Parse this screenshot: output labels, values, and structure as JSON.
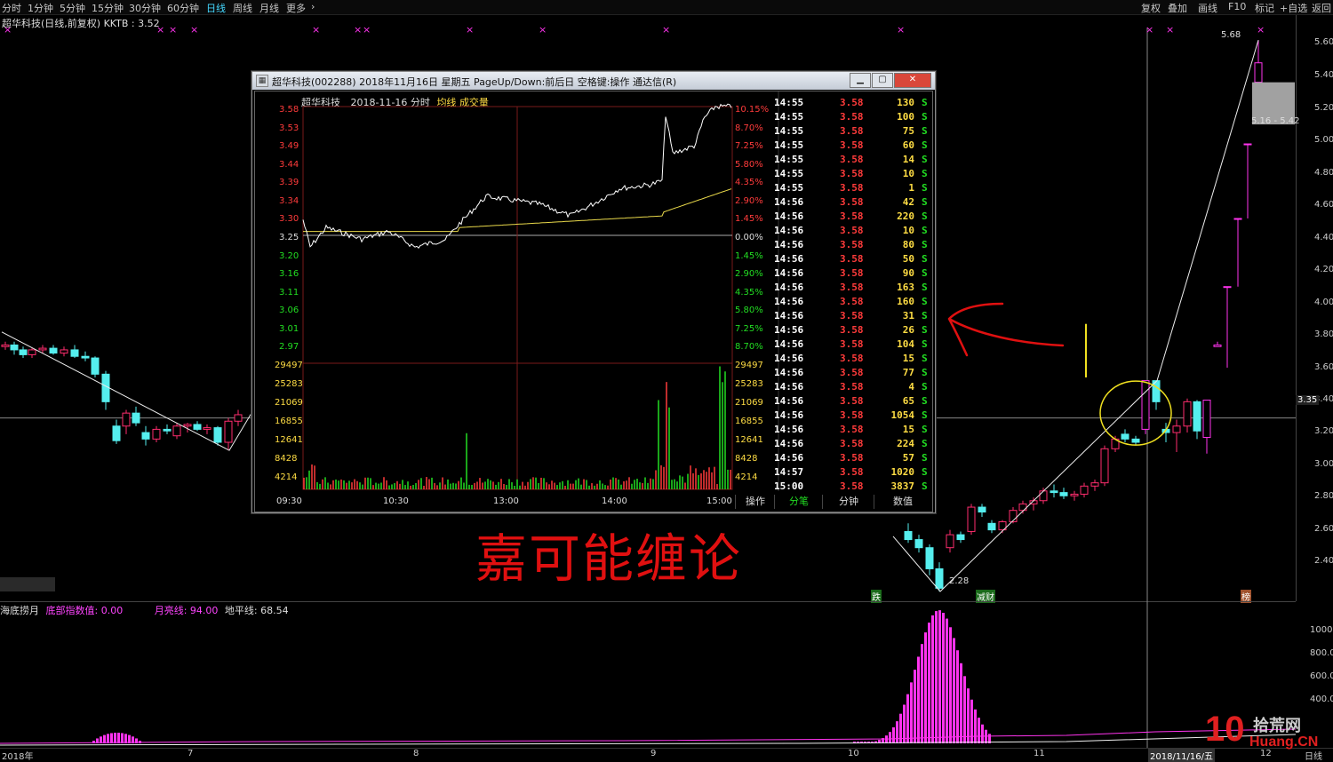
{
  "toolbar": {
    "periods": [
      "分时",
      "1分钟",
      "5分钟",
      "15分钟",
      "30分钟",
      "60分钟",
      "日线",
      "周线",
      "月线",
      "更多"
    ],
    "active": "日线",
    "right_tools": [
      "复权",
      "叠加",
      "画线",
      "F10",
      "标记",
      "+自选",
      "返回"
    ]
  },
  "chart_header": {
    "title": "超华科技(日线,前复权) KKTB : 3.52"
  },
  "colors": {
    "up": "#ff2d6e",
    "down": "#55eeee",
    "magenta": "#ff33ee",
    "avg": "#e8d84a",
    "grid_red": "#ff3b3b",
    "grid_green": "#22dd22"
  },
  "price_axis": {
    "labels": [
      "5.60",
      "5.40",
      "5.20",
      "5.00",
      "4.80",
      "4.60",
      "4.40",
      "4.20",
      "4.00",
      "3.80",
      "3.60",
      "3.40",
      "3.20",
      "3.00",
      "2.80",
      "2.60",
      "2.40"
    ],
    "crosshair": "3.35"
  },
  "annotations": {
    "high": "5.68",
    "low": "2.28",
    "range": "5.16 - 5.42",
    "calligraphy": "嘉可能缠论",
    "flags": [
      "跌",
      "减财",
      "榜"
    ]
  },
  "indicator": {
    "name": "海底捞月",
    "bottom_label": "底部指数值",
    "bottom_value": "0.00",
    "month_label": "月亮线",
    "month_value": "94.00",
    "ground_label": "地平线",
    "ground_value": "68.54",
    "axis": [
      "1000",
      "800.0",
      "600.0",
      "400.0"
    ]
  },
  "date_axis": [
    "2018年",
    "7",
    "8",
    "9",
    "10",
    "11",
    "2018/11/16/五",
    "12",
    "日线"
  ],
  "watermark": {
    "number": "10",
    "brand": "拾荒网",
    "url": "Huang.CN"
  },
  "popup": {
    "title": "超华科技(002288) 2018年11月16日 星期五 PageUp/Down:前后日 空格键:操作 通达信(R)",
    "header": {
      "name": "超华科技",
      "date": "2018-11-16 分时",
      "avg": "均线",
      "vol": "成交量"
    },
    "price_left": [
      "3.58",
      "3.53",
      "3.49",
      "3.44",
      "3.39",
      "3.34",
      "3.30",
      "3.25",
      "3.20",
      "3.16",
      "3.11",
      "3.06",
      "3.01",
      "2.97"
    ],
    "pct_right": [
      "10.15%",
      "8.70%",
      "7.25%",
      "5.80%",
      "4.35%",
      "2.90%",
      "1.45%",
      "0.00%",
      "1.45%",
      "2.90%",
      "4.35%",
      "5.80%",
      "7.25%",
      "8.70%"
    ],
    "vol_labels": [
      "29497",
      "25283",
      "21069",
      "16855",
      "12641",
      "8428",
      "4214"
    ],
    "time_labels": [
      "09:30",
      "10:30",
      "13:00",
      "14:00",
      "15:00"
    ],
    "tabs": [
      "操作",
      "分笔",
      "分钟",
      "数值"
    ],
    "active_tab": "分笔",
    "ticks": [
      {
        "t": "14:55",
        "p": "3.58",
        "v": "130",
        "s": "S"
      },
      {
        "t": "14:55",
        "p": "3.58",
        "v": "100",
        "s": "S"
      },
      {
        "t": "14:55",
        "p": "3.58",
        "v": "75",
        "s": "S"
      },
      {
        "t": "14:55",
        "p": "3.58",
        "v": "60",
        "s": "S"
      },
      {
        "t": "14:55",
        "p": "3.58",
        "v": "14",
        "s": "S"
      },
      {
        "t": "14:55",
        "p": "3.58",
        "v": "10",
        "s": "S"
      },
      {
        "t": "14:55",
        "p": "3.58",
        "v": "1",
        "s": "S"
      },
      {
        "t": "14:56",
        "p": "3.58",
        "v": "42",
        "s": "S"
      },
      {
        "t": "14:56",
        "p": "3.58",
        "v": "220",
        "s": "S"
      },
      {
        "t": "14:56",
        "p": "3.58",
        "v": "10",
        "s": "S"
      },
      {
        "t": "14:56",
        "p": "3.58",
        "v": "80",
        "s": "S"
      },
      {
        "t": "14:56",
        "p": "3.58",
        "v": "50",
        "s": "S"
      },
      {
        "t": "14:56",
        "p": "3.58",
        "v": "90",
        "s": "S"
      },
      {
        "t": "14:56",
        "p": "3.58",
        "v": "163",
        "s": "S"
      },
      {
        "t": "14:56",
        "p": "3.58",
        "v": "160",
        "s": "S"
      },
      {
        "t": "14:56",
        "p": "3.58",
        "v": "31",
        "s": "S"
      },
      {
        "t": "14:56",
        "p": "3.58",
        "v": "26",
        "s": "S"
      },
      {
        "t": "14:56",
        "p": "3.58",
        "v": "104",
        "s": "S"
      },
      {
        "t": "14:56",
        "p": "3.58",
        "v": "15",
        "s": "S"
      },
      {
        "t": "14:56",
        "p": "3.58",
        "v": "77",
        "s": "S"
      },
      {
        "t": "14:56",
        "p": "3.58",
        "v": "4",
        "s": "S"
      },
      {
        "t": "14:56",
        "p": "3.58",
        "v": "65",
        "s": "S"
      },
      {
        "t": "14:56",
        "p": "3.58",
        "v": "1054",
        "s": "S"
      },
      {
        "t": "14:56",
        "p": "3.58",
        "v": "15",
        "s": "S"
      },
      {
        "t": "14:56",
        "p": "3.58",
        "v": "224",
        "s": "S"
      },
      {
        "t": "14:56",
        "p": "3.58",
        "v": "57",
        "s": "S"
      },
      {
        "t": "14:57",
        "p": "3.58",
        "v": "1020",
        "s": "S"
      },
      {
        "t": "15:00",
        "p": "3.58",
        "v": "3837",
        "s": "S"
      }
    ]
  }
}
